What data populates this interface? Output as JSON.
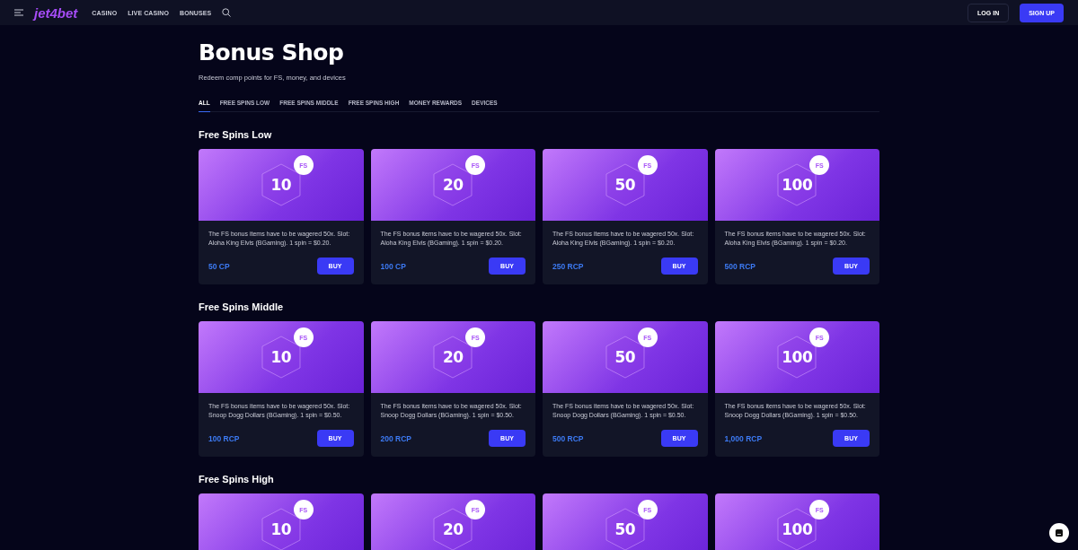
{
  "header": {
    "logo": "jet4bet",
    "nav": [
      "CASINO",
      "LIVE CASINO",
      "BONUSES"
    ],
    "login": "LOG IN",
    "signup": "SIGN UP"
  },
  "title": "Bonus Shop",
  "subtitle": "Redeem comp points for FS, money, and devices",
  "tabs": [
    {
      "label": "ALL",
      "selected": true
    },
    {
      "label": "FREE SPINS LOW",
      "selected": false
    },
    {
      "label": "FREE SPINS MIDDLE",
      "selected": false
    },
    {
      "label": "FREE SPINS HIGH",
      "selected": false
    },
    {
      "label": "MONEY REWARDS",
      "selected": false
    },
    {
      "label": "DEVICES",
      "selected": false
    }
  ],
  "sections": [
    {
      "heading": "Free Spins Low",
      "items": [
        {
          "amount": "10",
          "badge": "FS",
          "description": "The FS bonus items have to be wagered 50x. Slot: Aloha King Elvis (BGaming). 1 spin = $0.20.",
          "price": "50 CP",
          "button": "BUY"
        },
        {
          "amount": "20",
          "badge": "FS",
          "description": "The FS bonus items have to be wagered 50x. Slot: Aloha King Elvis (BGaming). 1 spin = $0.20.",
          "price": "100 CP",
          "button": "BUY"
        },
        {
          "amount": "50",
          "badge": "FS",
          "description": "The FS bonus items have to be wagered 50x. Slot: Aloha King Elvis (BGaming). 1 spin = $0.20.",
          "price": "250 RCP",
          "button": "BUY"
        },
        {
          "amount": "100",
          "badge": "FS",
          "description": "The FS bonus items have to be wagered 50x. Slot: Aloha King Elvis (BGaming). 1 spin = $0.20.",
          "price": "500 RCP",
          "button": "BUY"
        }
      ]
    },
    {
      "heading": "Free Spins Middle",
      "items": [
        {
          "amount": "10",
          "badge": "FS",
          "description": "The FS bonus items have to be wagered 50x. Slot: Snoop Dogg Dollars (BGaming). 1 spin = $0.50.",
          "price": "100 RCP",
          "button": "BUY"
        },
        {
          "amount": "20",
          "badge": "FS",
          "description": "The FS bonus items have to be wagered 50x. Slot: Snoop Dogg Dollars (BGaming). 1 spin = $0.50.",
          "price": "200 RCP",
          "button": "BUY"
        },
        {
          "amount": "50",
          "badge": "FS",
          "description": "The FS bonus items have to be wagered 50x. Slot: Snoop Dogg Dollars (BGaming). 1 spin = $0.50.",
          "price": "500 RCP",
          "button": "BUY"
        },
        {
          "amount": "100",
          "badge": "FS",
          "description": "The FS bonus items have to be wagered 50x. Slot: Snoop Dogg Dollars (BGaming). 1 spin = $0.50.",
          "price": "1,000 RCP",
          "button": "BUY"
        }
      ]
    },
    {
      "heading": "Free Spins High",
      "items": [
        {
          "amount": "10",
          "badge": "FS"
        },
        {
          "amount": "20",
          "badge": "FS"
        },
        {
          "amount": "50",
          "badge": "FS"
        },
        {
          "amount": "100",
          "badge": "FS"
        }
      ]
    }
  ]
}
